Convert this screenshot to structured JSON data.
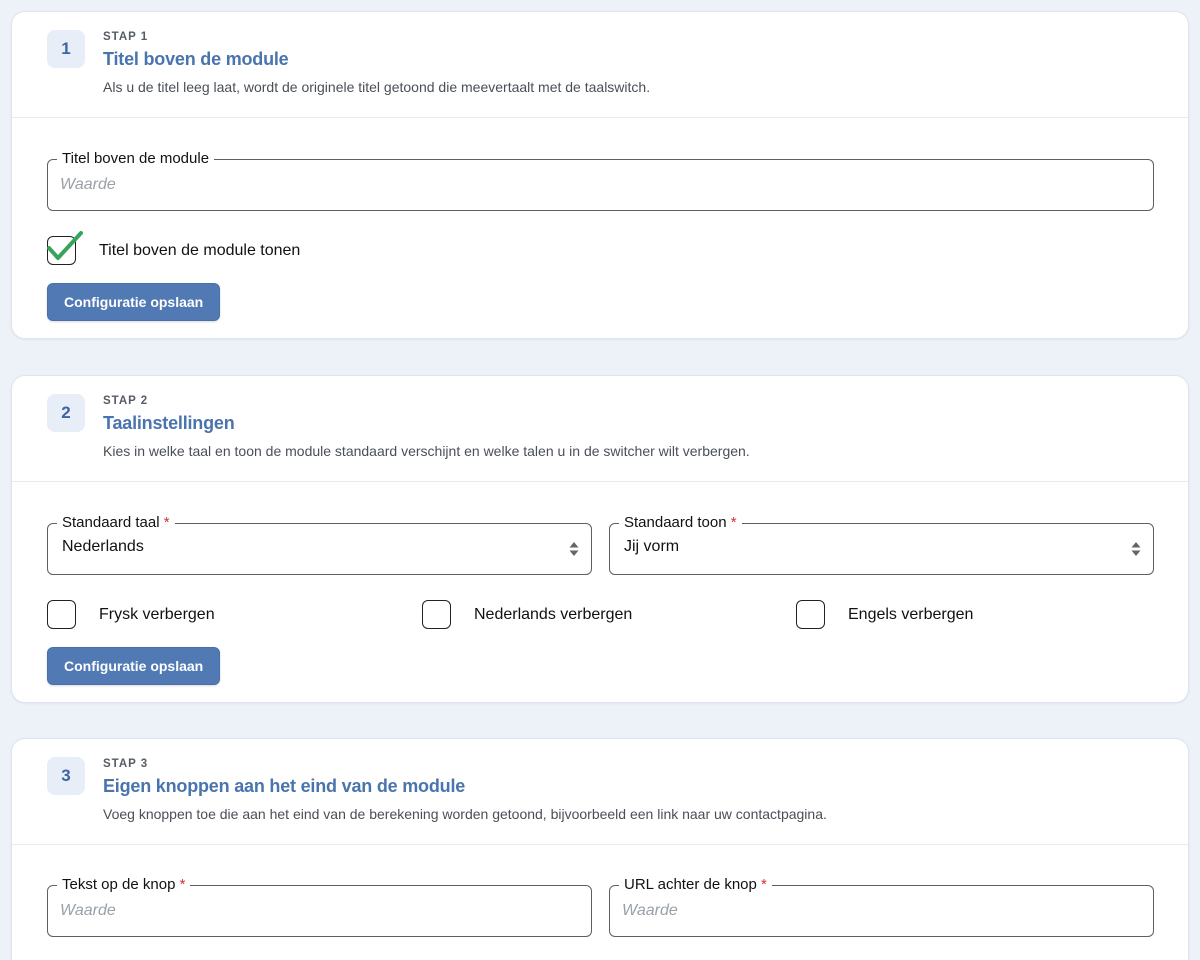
{
  "colors": {
    "page_background": "#edf1f8",
    "accent_title": "#4a74ad",
    "button": "#5179b4",
    "required": "#d0303a",
    "check": "#3aa35a"
  },
  "step1": {
    "badge": "1",
    "label": "STAP 1",
    "title": "Titel boven de module",
    "description": "Als u de titel leeg laat, wordt de originele titel getoond die meevertaalt met de taalswitch.",
    "field_label": "Titel boven de module",
    "field_placeholder": "Waarde",
    "field_value": "",
    "checkbox_label": "Titel boven de module tonen",
    "checkbox_checked": true,
    "save_label": "Configuratie opslaan"
  },
  "step2": {
    "badge": "2",
    "label": "STAP 2",
    "title": "Taalinstellingen",
    "description": "Kies in welke taal en toon de module standaard verschijnt en welke talen u in de switcher wilt verbergen.",
    "language_label": "Standaard taal",
    "language_value": "Nederlands",
    "tone_label": "Standaard toon",
    "tone_value": "Jij vorm",
    "required_mark": "*",
    "hide_frysk_label": "Frysk verbergen",
    "hide_dutch_label": "Nederlands verbergen",
    "hide_english_label": "Engels verbergen",
    "save_label": "Configuratie opslaan"
  },
  "step3": {
    "badge": "3",
    "label": "STAP 3",
    "title": "Eigen knoppen aan het eind van de module",
    "description": "Voeg knoppen toe die aan het eind van de berekening worden getoond, bijvoorbeeld een link naar uw contactpagina.",
    "button_text_label": "Tekst op de knop",
    "button_text_placeholder": "Waarde",
    "button_url_label": "URL achter de knop",
    "button_url_placeholder": "Waarde",
    "required_mark": "*"
  }
}
